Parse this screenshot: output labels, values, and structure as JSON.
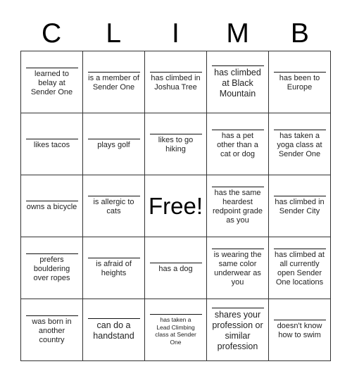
{
  "title_letters": [
    "C",
    "L",
    "I",
    "M",
    "B"
  ],
  "free_label": "Free!",
  "cells": [
    [
      "learned to belay at Sender One",
      "is a member of Sender One",
      "has climbed in Joshua Tree",
      "has climbed at Black Mountain",
      "has been to Europe"
    ],
    [
      "likes tacos",
      "plays golf",
      "likes to go hiking",
      "has a pet other than a cat or dog",
      "has taken a yoga class at Sender One"
    ],
    [
      "owns a bicycle",
      "is allergic to cats",
      "Free!",
      "has the same heardest redpoint grade as you",
      "has climbed in Sender City"
    ],
    [
      "prefers bouldering over ropes",
      "is afraid of heights",
      "has a dog",
      "is wearing the same color underwear as you",
      "has climbed at all currently open Sender One locations"
    ],
    [
      "was born in another country",
      "can do a handstand",
      "has taken a Lead Climbing class at Sender One",
      "shares your profession or similar profession",
      "doesn't know how to swim"
    ]
  ]
}
